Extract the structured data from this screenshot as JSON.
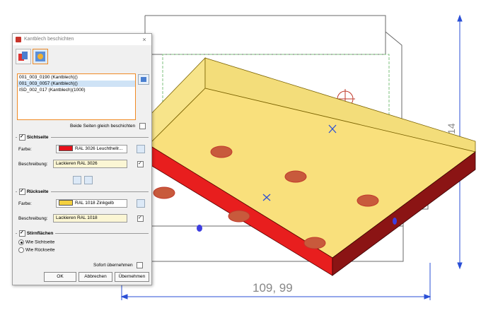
{
  "drawing": {
    "dim_width": "109, 99",
    "dim_height": "14"
  },
  "dialog": {
    "title": "Kantblech beschichten",
    "close_glyph": "×",
    "items": [
      "001_003_0190 (Kantblech)()",
      "001_003_0057 (Kantblech)()",
      "ISD_002_017 (Kantblech)(1000)"
    ],
    "selected_index": 1,
    "both_sides_label": "Beide Seiten gleich beschichten",
    "front": {
      "heading": "Sichtseite",
      "color_label": "Farbe:",
      "color_value": "RAL 3026 Leuchthellr...",
      "color_hex": "#e8101a",
      "desc_label": "Beschreibung:",
      "desc_value": "Lackieren RAL 3026"
    },
    "back": {
      "heading": "Rückseite",
      "color_label": "Farbe:",
      "color_value": "RAL 1018 Zinkgelb",
      "color_hex": "#f4d03f",
      "desc_label": "Beschreibung:",
      "desc_value": "Lackieren RAL 1018"
    },
    "faces": {
      "heading": "Stirnflächen",
      "option1": "Wie Sichtseite",
      "option2": "Wie Rückseite"
    },
    "apply_now_label": "Sofort übernehmen",
    "ok_label": "OK",
    "cancel_label": "Abbrechen",
    "apply_label": "Übernehmen"
  }
}
